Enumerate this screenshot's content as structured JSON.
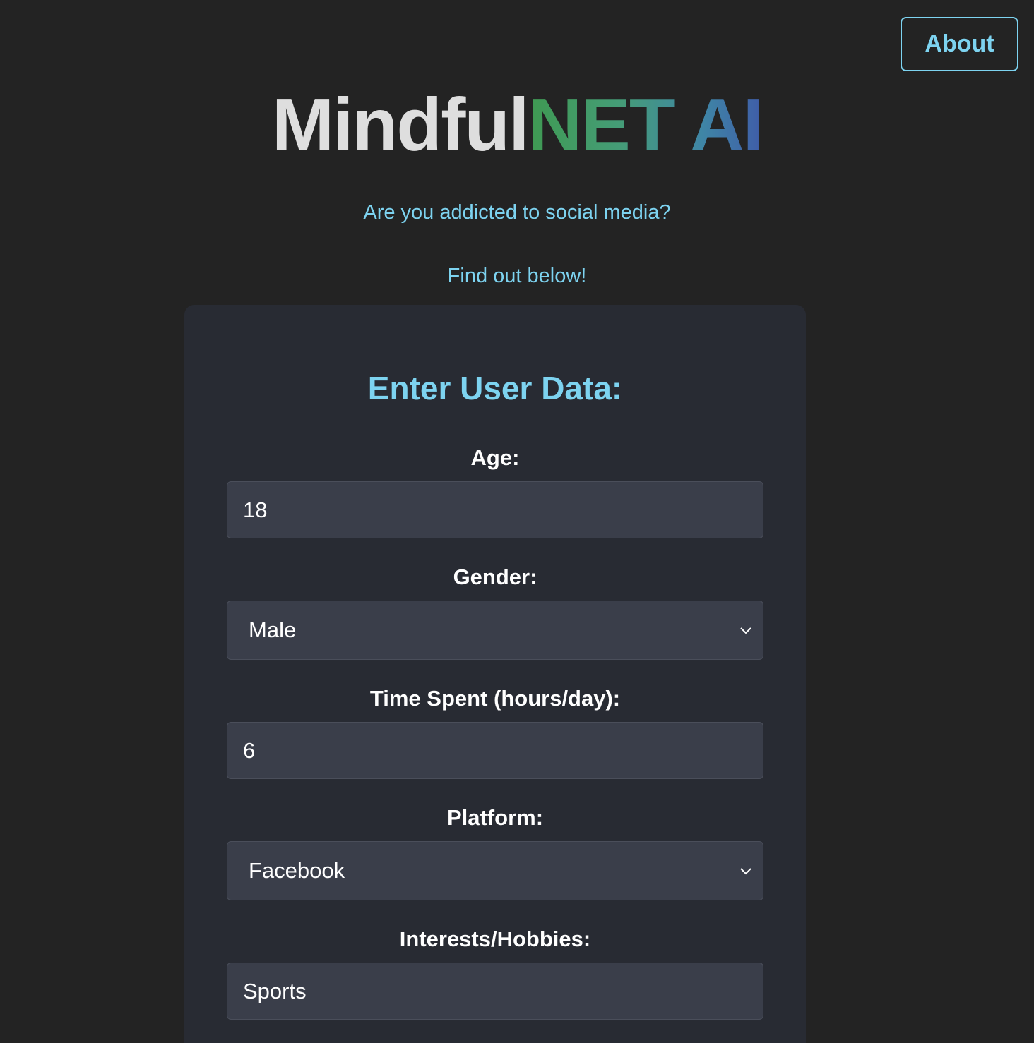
{
  "nav": {
    "about_label": "About"
  },
  "header": {
    "title_plain": "Mindful",
    "title_accent": "NET AI",
    "question": "Are you addicted to social media?",
    "prompt": "Find out below!"
  },
  "form": {
    "title": "Enter User Data:",
    "fields": [
      {
        "label": "Age:",
        "type": "number",
        "value": "18"
      },
      {
        "label": "Gender:",
        "type": "select",
        "value": "Male"
      },
      {
        "label": "Time Spent (hours/day):",
        "type": "number",
        "value": "6"
      },
      {
        "label": "Platform:",
        "type": "select",
        "value": "Facebook"
      },
      {
        "label": "Interests/Hobbies:",
        "type": "text",
        "value": "Sports"
      }
    ]
  },
  "colors": {
    "background": "#232323",
    "card": "#282b33",
    "accent": "#7dd3f0",
    "field": "#3a3e4a"
  }
}
